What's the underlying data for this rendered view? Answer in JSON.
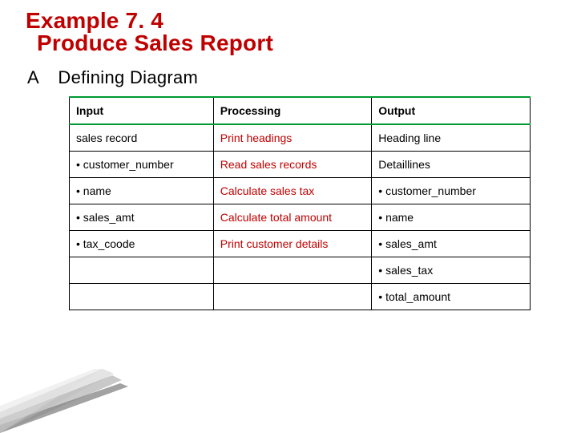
{
  "title": {
    "line1": "Example 7. 4",
    "line2": "Produce Sales Report"
  },
  "section": {
    "letter": "A",
    "label": "Defining Diagram"
  },
  "table": {
    "headers": {
      "c1": "Input",
      "c2": "Processing",
      "c3": "Output"
    },
    "rows": [
      {
        "c1": "sales record",
        "c2": "Print headings",
        "c3": "Heading line"
      },
      {
        "c1": "•  customer_number",
        "c2": "Read sales records",
        "c3": "Detaillines"
      },
      {
        "c1": "•  name",
        "c2": "Calculate sales tax",
        "c3": "•  customer_number"
      },
      {
        "c1": "•  sales_amt",
        "c2": "Calculate total amount",
        "c3": "•  name"
      },
      {
        "c1": "•  tax_coode",
        "c2": "Print customer details",
        "c3": "•  sales_amt"
      },
      {
        "c1": "",
        "c2": "",
        "c3": "•  sales_tax"
      },
      {
        "c1": "",
        "c2": "",
        "c3": "• total_amount"
      }
    ]
  }
}
